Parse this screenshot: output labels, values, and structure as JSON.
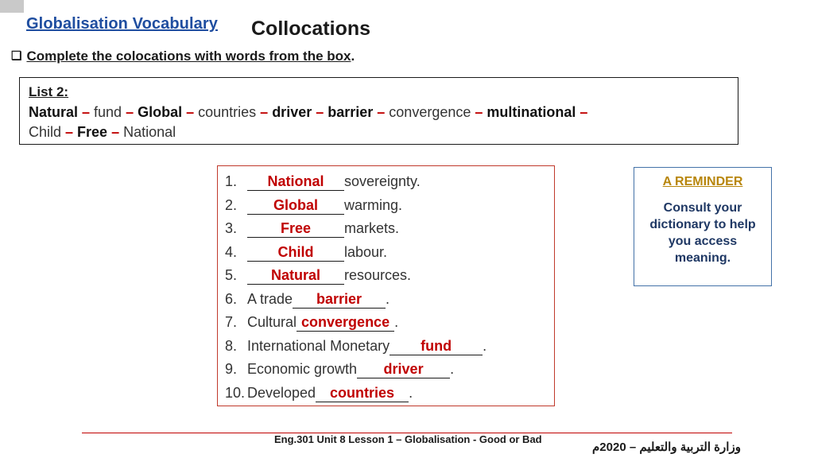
{
  "slide": {
    "title_link": "Globalisation Vocabulary",
    "title_main": "Collocations",
    "instruction_bullet": "❑",
    "instruction_underlined": "Complete the colocations with words from the box",
    "instruction_tail": "."
  },
  "wordbox": {
    "label": "List 2:",
    "line1": [
      {
        "t": "Natural",
        "bold": true
      },
      {
        "t": " – ",
        "dash": true
      },
      {
        "t": "fund",
        "bold": false
      },
      {
        "t": " – ",
        "dash": true
      },
      {
        "t": "Global",
        "bold": true
      },
      {
        "t": " – ",
        "dash": true
      },
      {
        "t": "countries",
        "bold": false
      },
      {
        "t": " – ",
        "dash": true
      },
      {
        "t": "driver",
        "bold": true
      },
      {
        "t": " – ",
        "dash": true
      },
      {
        "t": "barrier",
        "bold": true
      },
      {
        "t": " – ",
        "dash": true
      },
      {
        "t": "convergence",
        "bold": false
      },
      {
        "t": " – ",
        "dash": true
      },
      {
        "t": "multinational",
        "bold": true
      },
      {
        "t": "  – ",
        "dash": true
      }
    ],
    "line2": [
      {
        "t": "Child",
        "bold": false
      },
      {
        "t": " – ",
        "dash": true
      },
      {
        "t": "Free",
        "bold": true
      },
      {
        "t": " – ",
        "dash": true
      },
      {
        "t": "National",
        "bold": false
      }
    ]
  },
  "exercise": {
    "items": [
      {
        "num": "1.",
        "pre": "",
        "answer": "National",
        "post": " sovereignty.",
        "style": "lead"
      },
      {
        "num": "2.",
        "pre": "",
        "answer": "Global",
        "post": " warming.",
        "style": "lead"
      },
      {
        "num": "3.",
        "pre": "",
        "answer": "Free",
        "post": " markets.",
        "style": "lead"
      },
      {
        "num": "4.",
        "pre": "",
        "answer": "Child",
        "post": " labour.",
        "style": "lead"
      },
      {
        "num": "5.",
        "pre": "",
        "answer": "Natural",
        "post": " resources.",
        "style": "lead"
      },
      {
        "num": "6.",
        "pre": "A trade ",
        "answer": "barrier",
        "post": ".",
        "style": "trail"
      },
      {
        "num": "7.",
        "pre": "Cultural ",
        "answer": "convergence",
        "post": ".",
        "style": "trail"
      },
      {
        "num": "8.",
        "pre": "International Monetary ",
        "answer": "fund",
        "post": ".",
        "style": "trail"
      },
      {
        "num": "9.",
        "pre": "Economic growth ",
        "answer": "driver",
        "post": ".",
        "style": "trail"
      },
      {
        "num": "10.",
        "pre": "Developed ",
        "answer": "countries",
        "post": ".",
        "style": "trail"
      }
    ]
  },
  "reminder": {
    "title": "A REMINDER",
    "body": "Consult your dictionary to help you access meaning."
  },
  "footer": {
    "center": "Eng.301 Unit 8 Lesson 1 – Globalisation - Good or Bad",
    "arabic": "وزارة التربية والتعليم – 2020م"
  },
  "colors": {
    "answer_red": "#c00000",
    "title_blue": "#1f4ea0",
    "reminder_border": "#4472a8",
    "reminder_title": "#b8860b",
    "reminder_body": "#1f3864",
    "exercise_border": "#c0392b"
  }
}
